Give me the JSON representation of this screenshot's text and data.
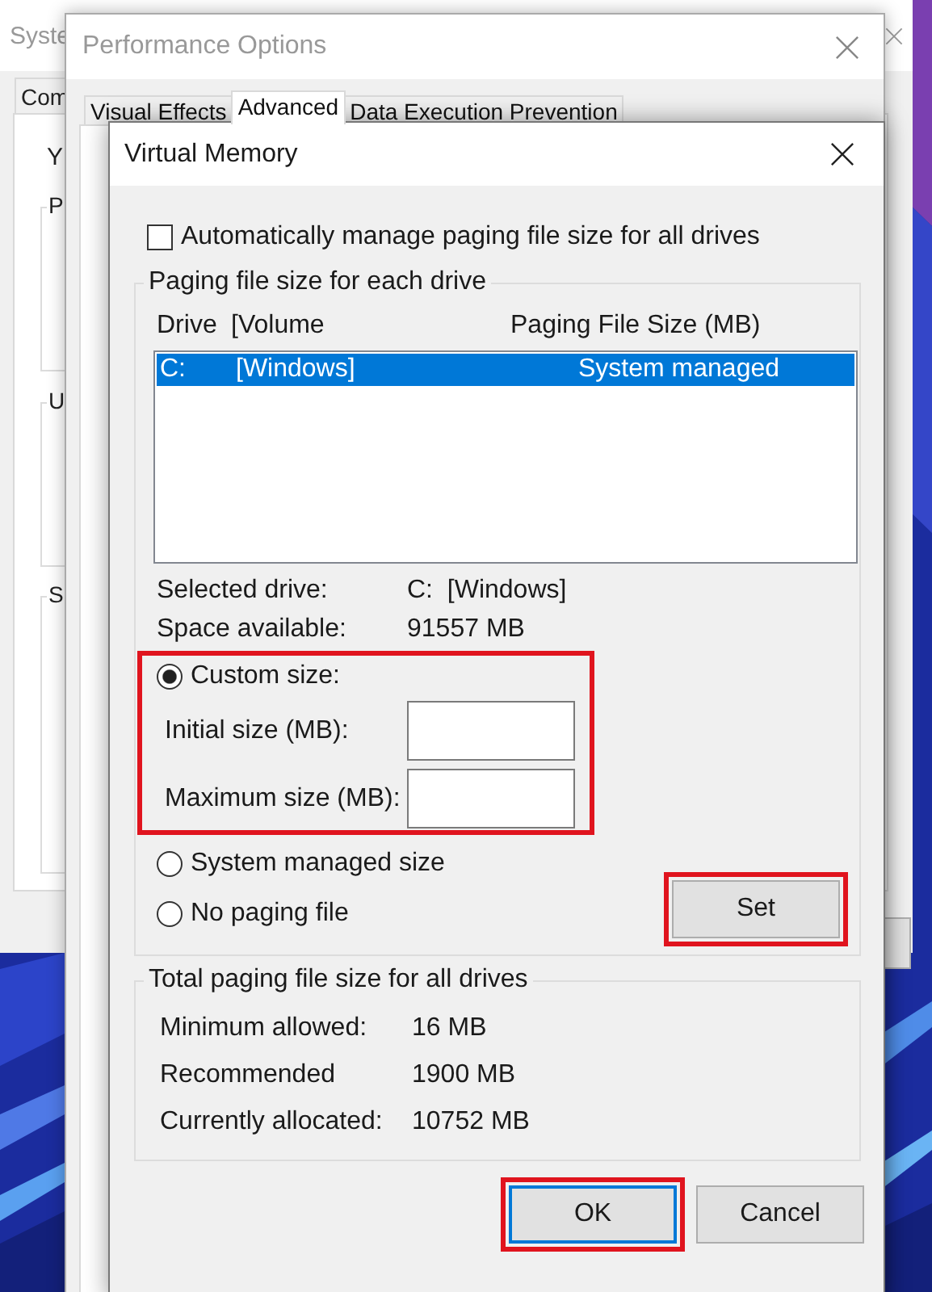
{
  "system_window": {
    "title": "Syste",
    "tab": "Com",
    "text": "Y",
    "groups": [
      "P",
      "U",
      "S"
    ]
  },
  "performance_window": {
    "title": "Performance Options",
    "tabs": [
      {
        "label": "Visual Effects",
        "selected": false
      },
      {
        "label": "Advanced",
        "selected": true
      },
      {
        "label": "Data Execution Prevention",
        "selected": false
      }
    ]
  },
  "dialog": {
    "title": "Virtual Memory",
    "auto_manage": {
      "label": "Automatically manage paging file size for all drives",
      "checked": false
    },
    "drives_group": {
      "title": "Paging file size for each drive",
      "columns": [
        "Drive",
        "[Volume",
        "Paging File Size (MB)"
      ],
      "rows": [
        {
          "drive": "C:",
          "volume": "[Windows]",
          "size": "System managed",
          "selected": true
        }
      ],
      "info": [
        {
          "label": "Selected drive:",
          "value": "C:  [Windows]"
        },
        {
          "label": "Space available:",
          "value": "91557 MB"
        }
      ],
      "size_options": [
        {
          "kind": "custom",
          "label": "Custom size:",
          "selected": true,
          "highlighted": true,
          "fields": [
            {
              "label": "Initial size (MB):"
            },
            {
              "label": "Maximum size (MB):"
            }
          ]
        },
        {
          "kind": "plain",
          "label": "System managed size",
          "selected": false
        },
        {
          "kind": "plain",
          "label": "No paging file",
          "selected": false
        }
      ],
      "set_button": {
        "label": "Set",
        "highlighted": true
      }
    },
    "totals_group": {
      "title": "Total paging file size for all drives",
      "rows": [
        {
          "label": "Minimum allowed:",
          "value": "16 MB"
        },
        {
          "label": "Recommended",
          "value": "1900 MB"
        },
        {
          "label": "Currently allocated:",
          "value": "10752 MB"
        }
      ]
    },
    "buttons": [
      {
        "label": "OK",
        "default": true,
        "highlighted": true
      },
      {
        "label": "Cancel",
        "default": false,
        "highlighted": false
      }
    ]
  }
}
